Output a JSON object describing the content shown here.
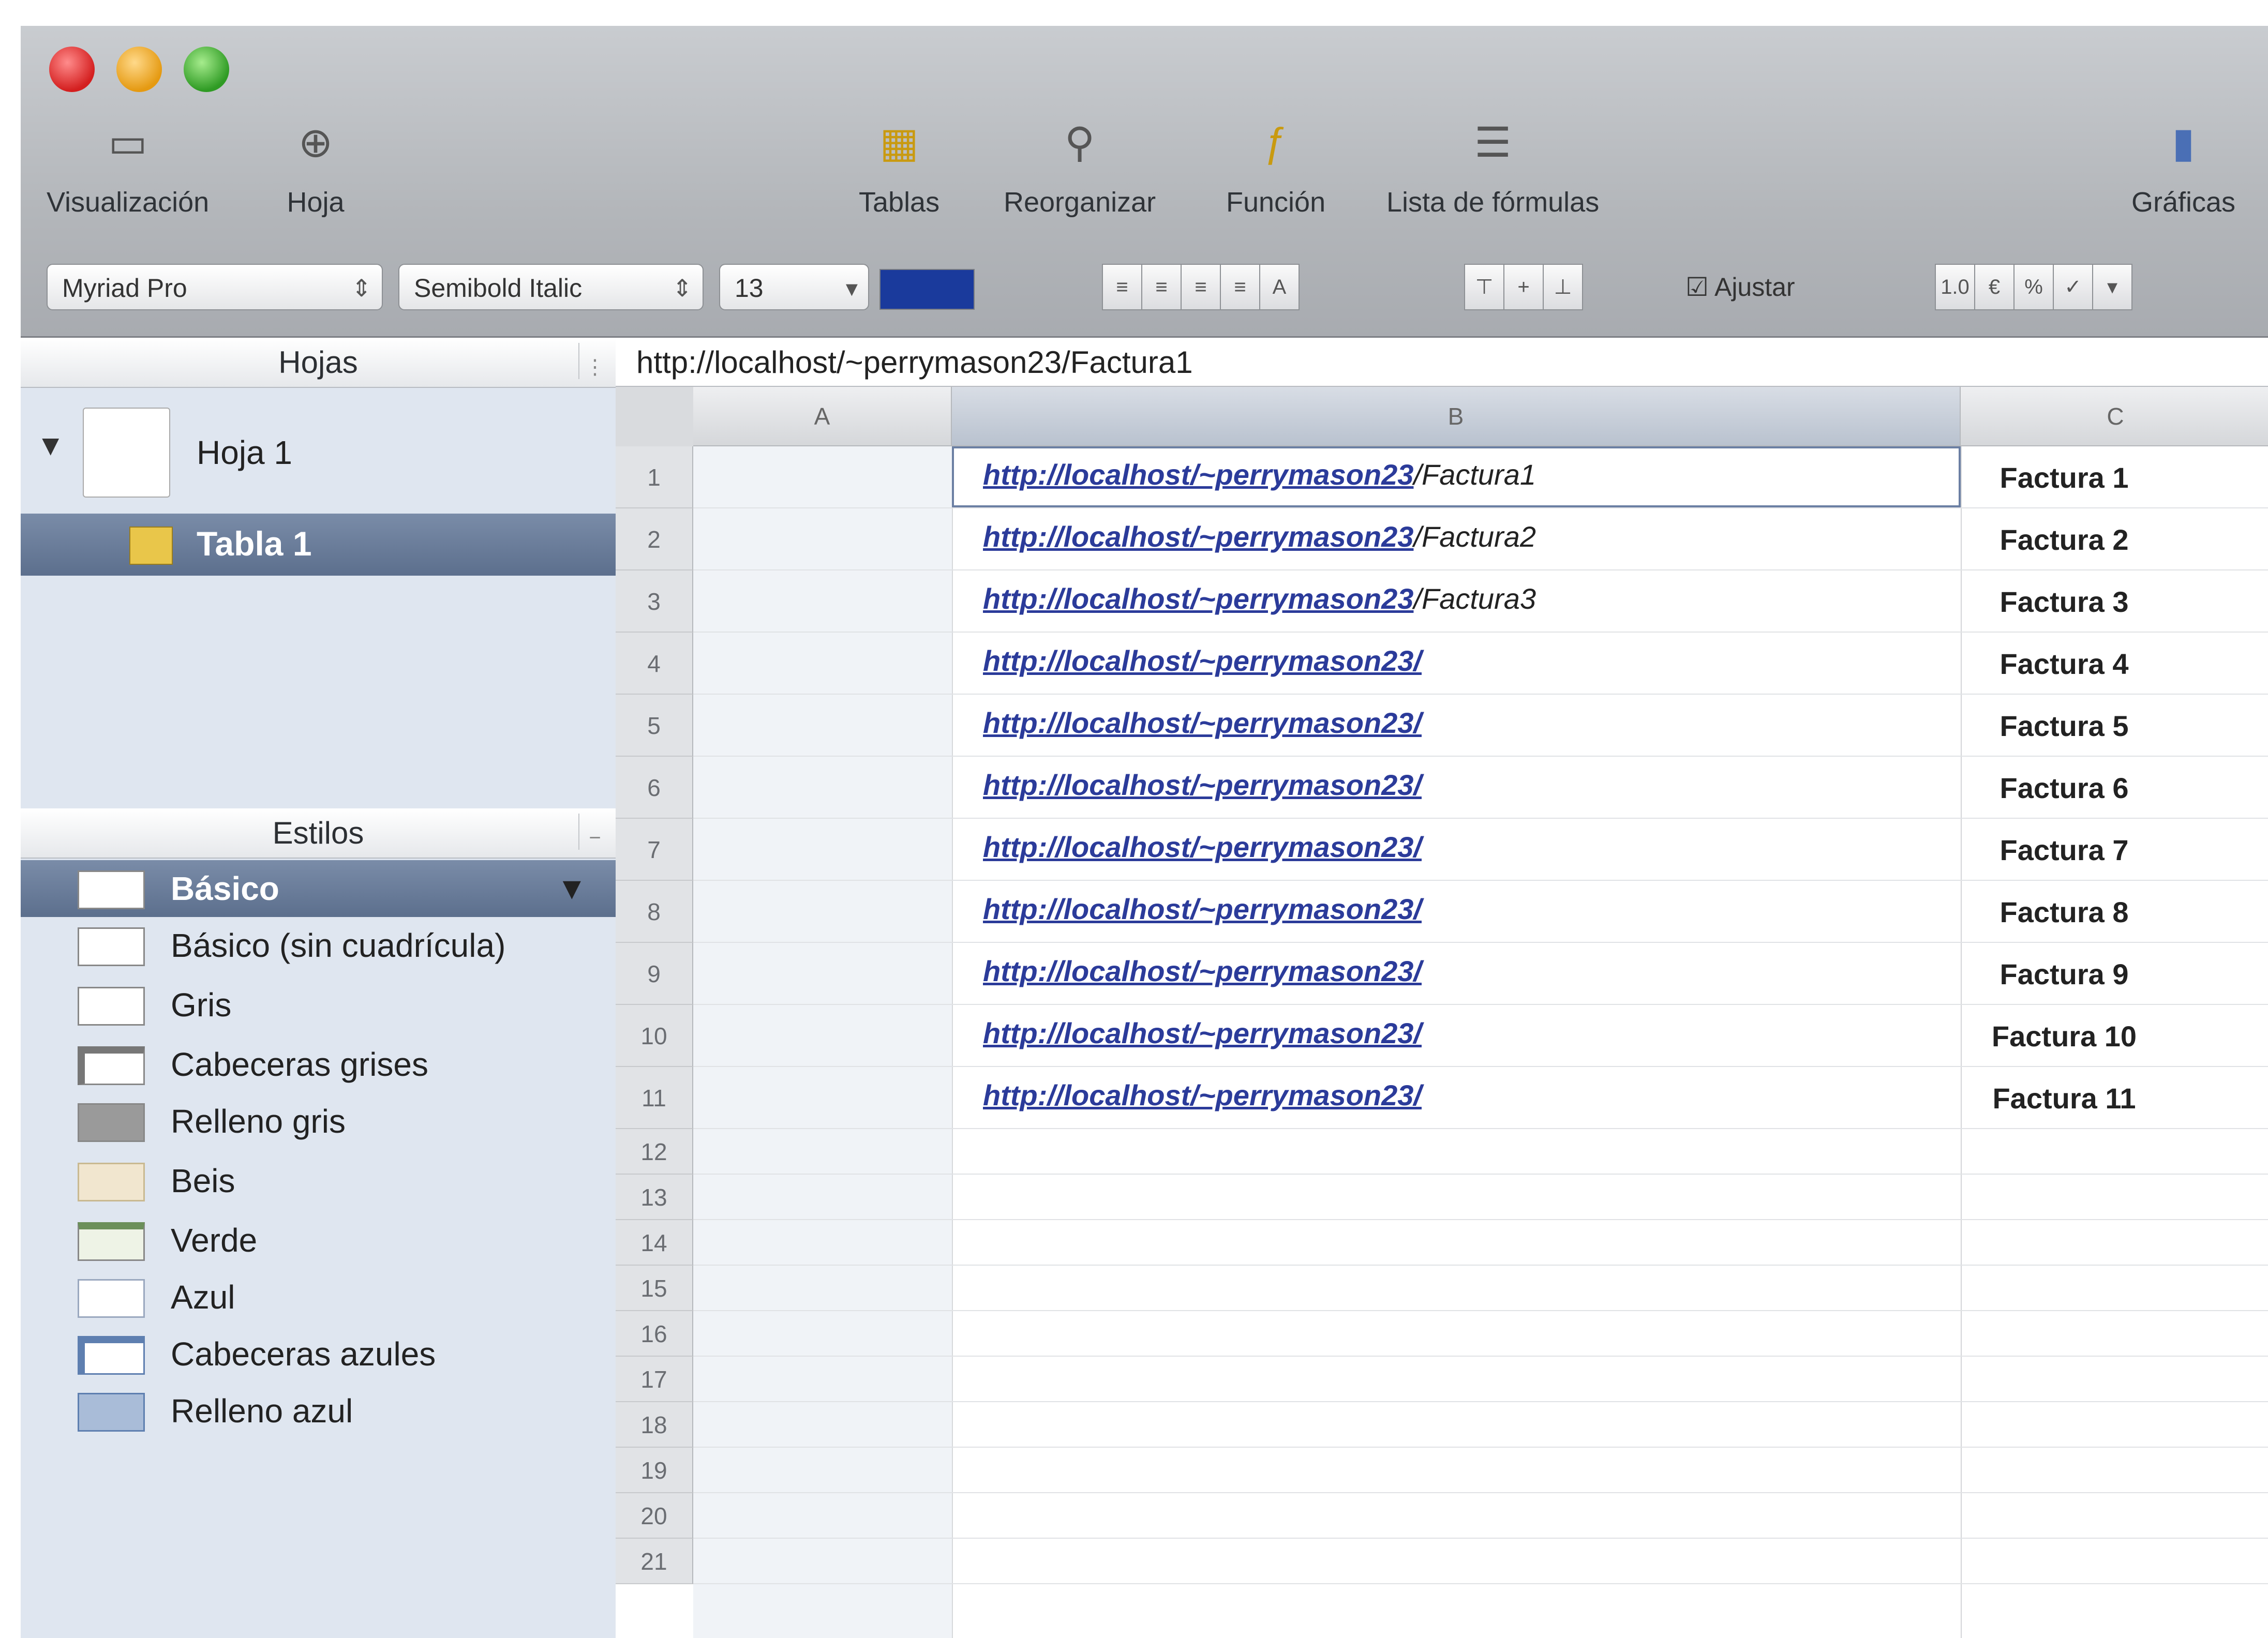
{
  "toolbar": {
    "tools": [
      {
        "id": "visualizacion",
        "label": "Visualización"
      },
      {
        "id": "hoja",
        "label": "Hoja"
      },
      {
        "id": "tablas",
        "label": "Tablas"
      },
      {
        "id": "reorganizar",
        "label": "Reorganizar"
      },
      {
        "id": "funcion",
        "label": "Función"
      },
      {
        "id": "lista_formulas",
        "label": "Lista de fórmulas"
      },
      {
        "id": "graficas",
        "label": "Gráficas"
      }
    ],
    "font_family_value": "Myriad Pro",
    "font_style_value": "Semibold Italic",
    "font_size_value": "13",
    "wrap_label": "Ajustar",
    "text_color": "#1a3a9c"
  },
  "sidebar": {
    "sheets_header": "Hojas",
    "sheet_name": "Hoja 1",
    "table_name": "Tabla 1",
    "styles_header": "Estilos",
    "styles": [
      "Básico",
      "Básico (sin cuadrícula)",
      "Gris",
      "Cabeceras grises",
      "Relleno gris",
      "Beis",
      "Verde",
      "Azul",
      "Cabeceras azules",
      "Relleno azul"
    ]
  },
  "formula_bar": {
    "value": "http://localhost/~perrymason23/Factura1"
  },
  "grid": {
    "columns": [
      "A",
      "B",
      "C"
    ],
    "rows": [
      {
        "n": "1",
        "link": "http://localhost/~perrymason23",
        "tail": "/Factura1",
        "c": "Factura 1"
      },
      {
        "n": "2",
        "link": "http://localhost/~perrymason23",
        "tail": "/Factura2",
        "c": "Factura 2"
      },
      {
        "n": "3",
        "link": "http://localhost/~perrymason23",
        "tail": "/Factura3",
        "c": "Factura 3"
      },
      {
        "n": "4",
        "link": "http://localhost/~perrymason23/",
        "tail": "",
        "c": "Factura 4"
      },
      {
        "n": "5",
        "link": "http://localhost/~perrymason23/",
        "tail": "",
        "c": "Factura 5"
      },
      {
        "n": "6",
        "link": "http://localhost/~perrymason23/",
        "tail": "",
        "c": "Factura 6"
      },
      {
        "n": "7",
        "link": "http://localhost/~perrymason23/",
        "tail": "",
        "c": "Factura 7"
      },
      {
        "n": "8",
        "link": "http://localhost/~perrymason23/",
        "tail": "",
        "c": "Factura 8"
      },
      {
        "n": "9",
        "link": "http://localhost/~perrymason23/",
        "tail": "",
        "c": "Factura 9"
      },
      {
        "n": "10",
        "link": "http://localhost/~perrymason23/",
        "tail": "",
        "c": "Factura 10"
      },
      {
        "n": "11",
        "link": "http://localhost/~perrymason23/",
        "tail": "",
        "c": "Factura 11"
      }
    ],
    "empty_rows": [
      "12",
      "13",
      "14",
      "15",
      "16",
      "17",
      "18",
      "19",
      "20",
      "21"
    ]
  }
}
